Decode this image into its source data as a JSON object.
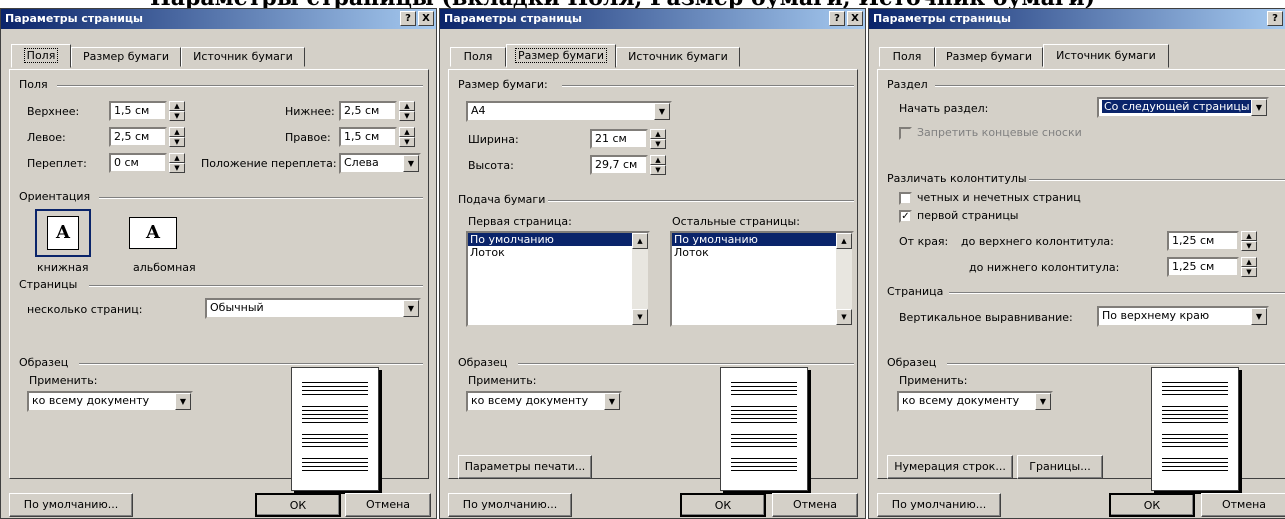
{
  "header_text": "Параметры страницы (вкладки Поля, Размер бумаги, Источник бумаги)",
  "dialog_title": "Параметры страницы",
  "title_buttons": {
    "help": "?",
    "close": "X"
  },
  "tabs": [
    "Поля",
    "Размер бумаги",
    "Источник бумаги"
  ],
  "footer": {
    "default_btn": "По умолчанию...",
    "ok_btn": "ОК",
    "cancel_btn": "Отмена"
  },
  "sample": {
    "group": "Образец",
    "apply_label": "Применить:",
    "apply_value": "ко всему документу"
  },
  "margins": {
    "group": "Поля",
    "top_label": "Верхнее:",
    "top_value": "1,5 см",
    "bottom_label": "Нижнее:",
    "bottom_value": "2,5 см",
    "left_label": "Левое:",
    "left_value": "2,5 см",
    "right_label": "Правое:",
    "right_value": "1,5 см",
    "gutter_label": "Переплет:",
    "gutter_value": "0 см",
    "gutter_pos_label": "Положение переплета:",
    "gutter_pos_value": "Слева",
    "orientation_group": "Ориентация",
    "portrait": "книжная",
    "landscape": "альбомная",
    "pages_group": "Страницы",
    "multiple_label": "несколько страниц:",
    "multiple_value": "Обычный"
  },
  "paper": {
    "group": "Размер бумаги:",
    "size_value": "A4",
    "width_label": "Ширина:",
    "width_value": "21 см",
    "height_label": "Высота:",
    "height_value": "29,7 см",
    "source_group": "Подача бумаги",
    "first_label": "Первая страница:",
    "other_label": "Остальные страницы:",
    "first_items": [
      "По умолчанию",
      "Лоток"
    ],
    "other_items": [
      "По умолчанию",
      "Лоток"
    ],
    "print_options_btn": "Параметры печати..."
  },
  "layout": {
    "section_group": "Раздел",
    "section_start_label": "Начать раздел:",
    "section_start_value": "Со следующей страницы",
    "suppress_endnotes": "Запретить концевые сноски",
    "hf_group": "Различать колонтитулы",
    "odd_even": "четных и нечетных страниц",
    "first_page": "первой страницы",
    "from_edge": "От края:",
    "header_label": "до верхнего колонтитула:",
    "header_value": "1,25 см",
    "footer_label": "до нижнего колонтитула:",
    "footer_value": "1,25 см",
    "page_group": "Страница",
    "valign_label": "Вертикальное выравнивание:",
    "valign_value": "По верхнему краю",
    "line_numbers_btn": "Нумерация строк...",
    "borders_btn": "Границы..."
  }
}
